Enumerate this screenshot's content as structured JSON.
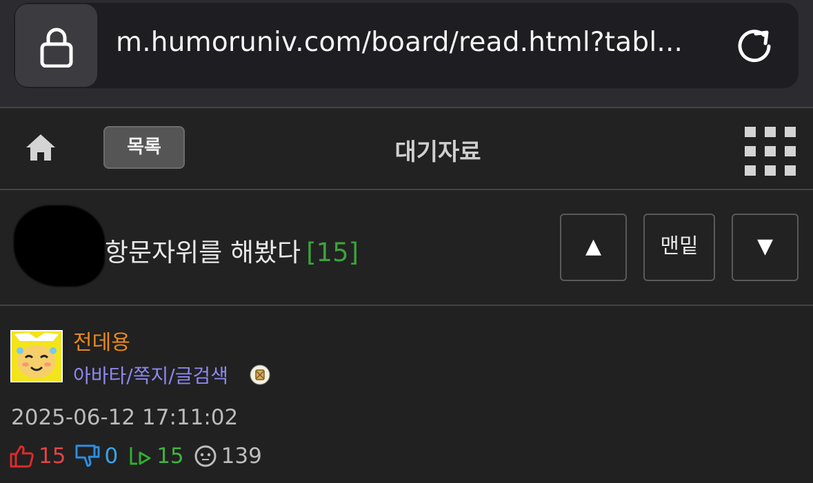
{
  "browser": {
    "url": "m.humoruniv.com/board/read.html?tabl..."
  },
  "nav": {
    "list_label": "목록",
    "title": "대기자료"
  },
  "post": {
    "title": "항문자위를 해봤다",
    "comment_count": "[15]",
    "controls": {
      "up": "▲",
      "bottom": "맨밑",
      "down": "▼"
    }
  },
  "author": {
    "name": "전데용",
    "links": "아바타/쪽지/글검색"
  },
  "meta": {
    "date": "2025-06-12 17:11:02",
    "likes": "15",
    "dislikes": "0",
    "shares": "15",
    "views": "139"
  },
  "colors": {
    "accent_name": "#e98a17",
    "link": "#8d87ee",
    "comment_count": "#3ca33c",
    "like": "#e04545",
    "dislike": "#3ba4e6",
    "share": "#42b042"
  }
}
